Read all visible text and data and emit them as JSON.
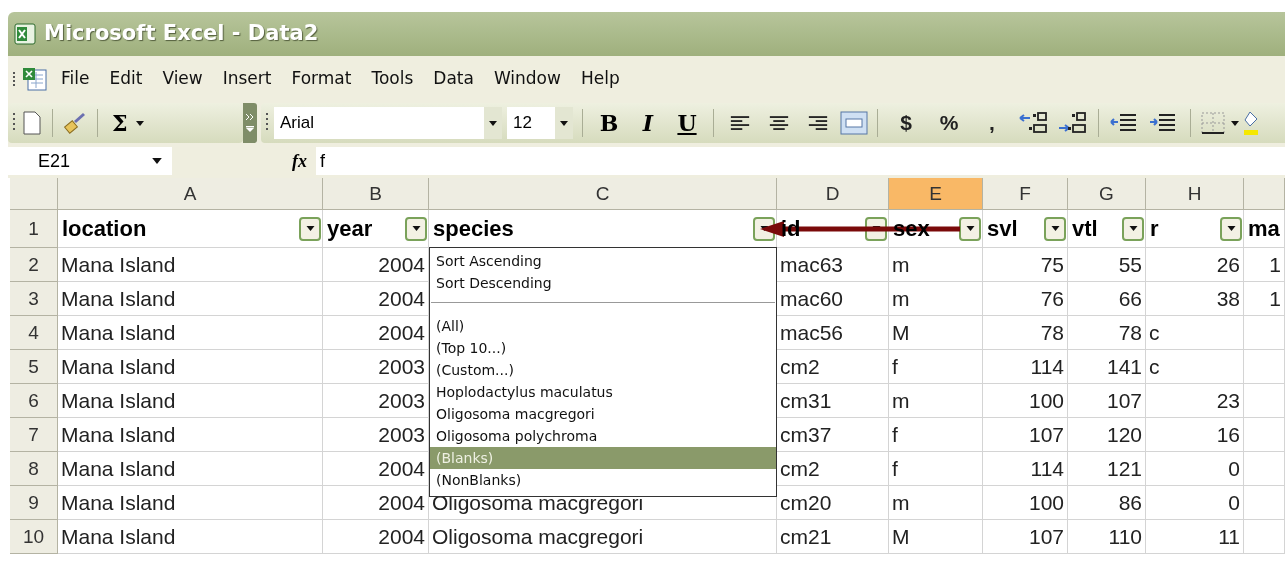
{
  "window": {
    "title": "Microsoft Excel - Data2"
  },
  "menu": [
    {
      "label": "File"
    },
    {
      "label": "Edit"
    },
    {
      "label": "View"
    },
    {
      "label": "Insert"
    },
    {
      "label": "Format"
    },
    {
      "label": "Tools"
    },
    {
      "label": "Data"
    },
    {
      "label": "Window"
    },
    {
      "label": "Help"
    }
  ],
  "standard_toolbar": {
    "sum": "Σ"
  },
  "formatting_toolbar": {
    "font": "Arial",
    "size": "12",
    "style_buttons": [
      "B",
      "I",
      "U"
    ],
    "number_buttons": [
      "$",
      "%",
      ","
    ]
  },
  "formula_bar": {
    "name_box": "E21",
    "function_label": "fx",
    "formula": "f"
  },
  "header_row_number": "1",
  "columns": [
    {
      "letter": "A",
      "header": "location",
      "selected": false,
      "filter": true
    },
    {
      "letter": "B",
      "header": "year",
      "selected": false,
      "filter": true
    },
    {
      "letter": "C",
      "header": "species",
      "selected": false,
      "filter": true
    },
    {
      "letter": "D",
      "header": "id",
      "selected": false,
      "filter": true
    },
    {
      "letter": "E",
      "header": "sex",
      "selected": true,
      "filter": true
    },
    {
      "letter": "F",
      "header": "svl",
      "selected": false,
      "filter": true
    },
    {
      "letter": "G",
      "header": "vtl",
      "selected": false,
      "filter": true
    },
    {
      "letter": "H",
      "header": "r",
      "selected": false,
      "filter": true
    },
    {
      "header": "ma",
      "selected": false,
      "filter": false
    }
  ],
  "rows": [
    {
      "number": "2",
      "cells": [
        {
          "text": "Mana Island",
          "kind": "text"
        },
        {
          "text": "2004",
          "kind": "number"
        },
        null,
        {
          "text": "mac63",
          "kind": "text"
        },
        {
          "text": "m",
          "kind": "text"
        },
        {
          "text": "75",
          "kind": "number"
        },
        {
          "text": "55",
          "kind": "number"
        },
        {
          "text": "26",
          "kind": "number"
        },
        {
          "text": "1",
          "kind": "number"
        }
      ]
    },
    {
      "number": "3",
      "cells": [
        {
          "text": "Mana Island",
          "kind": "text"
        },
        {
          "text": "2004",
          "kind": "number"
        },
        null,
        {
          "text": "mac60",
          "kind": "text"
        },
        {
          "text": "m",
          "kind": "text"
        },
        {
          "text": "76",
          "kind": "number"
        },
        {
          "text": "66",
          "kind": "number"
        },
        {
          "text": "38",
          "kind": "number"
        },
        {
          "text": "1",
          "kind": "number"
        }
      ]
    },
    {
      "number": "4",
      "cells": [
        {
          "text": "Mana Island",
          "kind": "text"
        },
        {
          "text": "2004",
          "kind": "number"
        },
        null,
        {
          "text": "mac56",
          "kind": "text"
        },
        {
          "text": "M",
          "kind": "text"
        },
        {
          "text": "78",
          "kind": "number"
        },
        {
          "text": "78",
          "kind": "number"
        },
        {
          "text": "c",
          "kind": "text"
        },
        null
      ]
    },
    {
      "number": "5",
      "cells": [
        {
          "text": "Mana Island",
          "kind": "text"
        },
        {
          "text": "2003",
          "kind": "number"
        },
        null,
        {
          "text": "cm2",
          "kind": "text"
        },
        {
          "text": "f",
          "kind": "text"
        },
        {
          "text": "114",
          "kind": "number"
        },
        {
          "text": "141",
          "kind": "number"
        },
        {
          "text": "c",
          "kind": "text"
        },
        null
      ]
    },
    {
      "number": "6",
      "cells": [
        {
          "text": "Mana Island",
          "kind": "text"
        },
        {
          "text": "2003",
          "kind": "number"
        },
        null,
        {
          "text": "cm31",
          "kind": "text"
        },
        {
          "text": "m",
          "kind": "text"
        },
        {
          "text": "100",
          "kind": "number"
        },
        {
          "text": "107",
          "kind": "number"
        },
        {
          "text": "23",
          "kind": "number"
        },
        null
      ]
    },
    {
      "number": "7",
      "cells": [
        {
          "text": "Mana Island",
          "kind": "text"
        },
        {
          "text": "2003",
          "kind": "number"
        },
        null,
        {
          "text": "cm37",
          "kind": "text"
        },
        {
          "text": "f",
          "kind": "text"
        },
        {
          "text": "107",
          "kind": "number"
        },
        {
          "text": "120",
          "kind": "number"
        },
        {
          "text": "16",
          "kind": "number"
        },
        null
      ]
    },
    {
      "number": "8",
      "cells": [
        {
          "text": "Mana Island",
          "kind": "text"
        },
        {
          "text": "2004",
          "kind": "number"
        },
        null,
        {
          "text": "cm2",
          "kind": "text"
        },
        {
          "text": "f",
          "kind": "text"
        },
        {
          "text": "114",
          "kind": "number"
        },
        {
          "text": "121",
          "kind": "number"
        },
        {
          "text": "0",
          "kind": "number"
        },
        null
      ]
    },
    {
      "number": "9",
      "cells": [
        {
          "text": "Mana Island",
          "kind": "text"
        },
        {
          "text": "2004",
          "kind": "number"
        },
        {
          "text": "Oligosoma macgregori",
          "kind": "text"
        },
        {
          "text": "cm20",
          "kind": "text"
        },
        {
          "text": "m",
          "kind": "text"
        },
        {
          "text": "100",
          "kind": "number"
        },
        {
          "text": "86",
          "kind": "number"
        },
        {
          "text": "0",
          "kind": "number"
        },
        null
      ]
    },
    {
      "number": "10",
      "cells": [
        {
          "text": "Mana Island",
          "kind": "text"
        },
        {
          "text": "2004",
          "kind": "number"
        },
        {
          "text": "Oligosoma macgregori",
          "kind": "text"
        },
        {
          "text": "cm21",
          "kind": "text"
        },
        {
          "text": "M",
          "kind": "text"
        },
        {
          "text": "107",
          "kind": "number"
        },
        {
          "text": "110",
          "kind": "number"
        },
        {
          "text": "11",
          "kind": "number"
        },
        null
      ]
    }
  ],
  "filter_dropdown": {
    "sort_items": [
      "Sort Ascending",
      "Sort Descending"
    ],
    "filter_items": [
      {
        "label": "(All)",
        "selected": false
      },
      {
        "label": "(Top 10...)",
        "selected": false
      },
      {
        "label": "(Custom...)",
        "selected": false
      },
      {
        "label": "Hoplodactylus maculatus",
        "selected": false
      },
      {
        "label": "Oligosoma macgregori",
        "selected": false
      },
      {
        "label": "Oligosoma polychroma",
        "selected": false
      },
      {
        "label": "(Blanks)",
        "selected": true
      },
      {
        "label": "(NonBlanks)",
        "selected": false
      }
    ]
  }
}
